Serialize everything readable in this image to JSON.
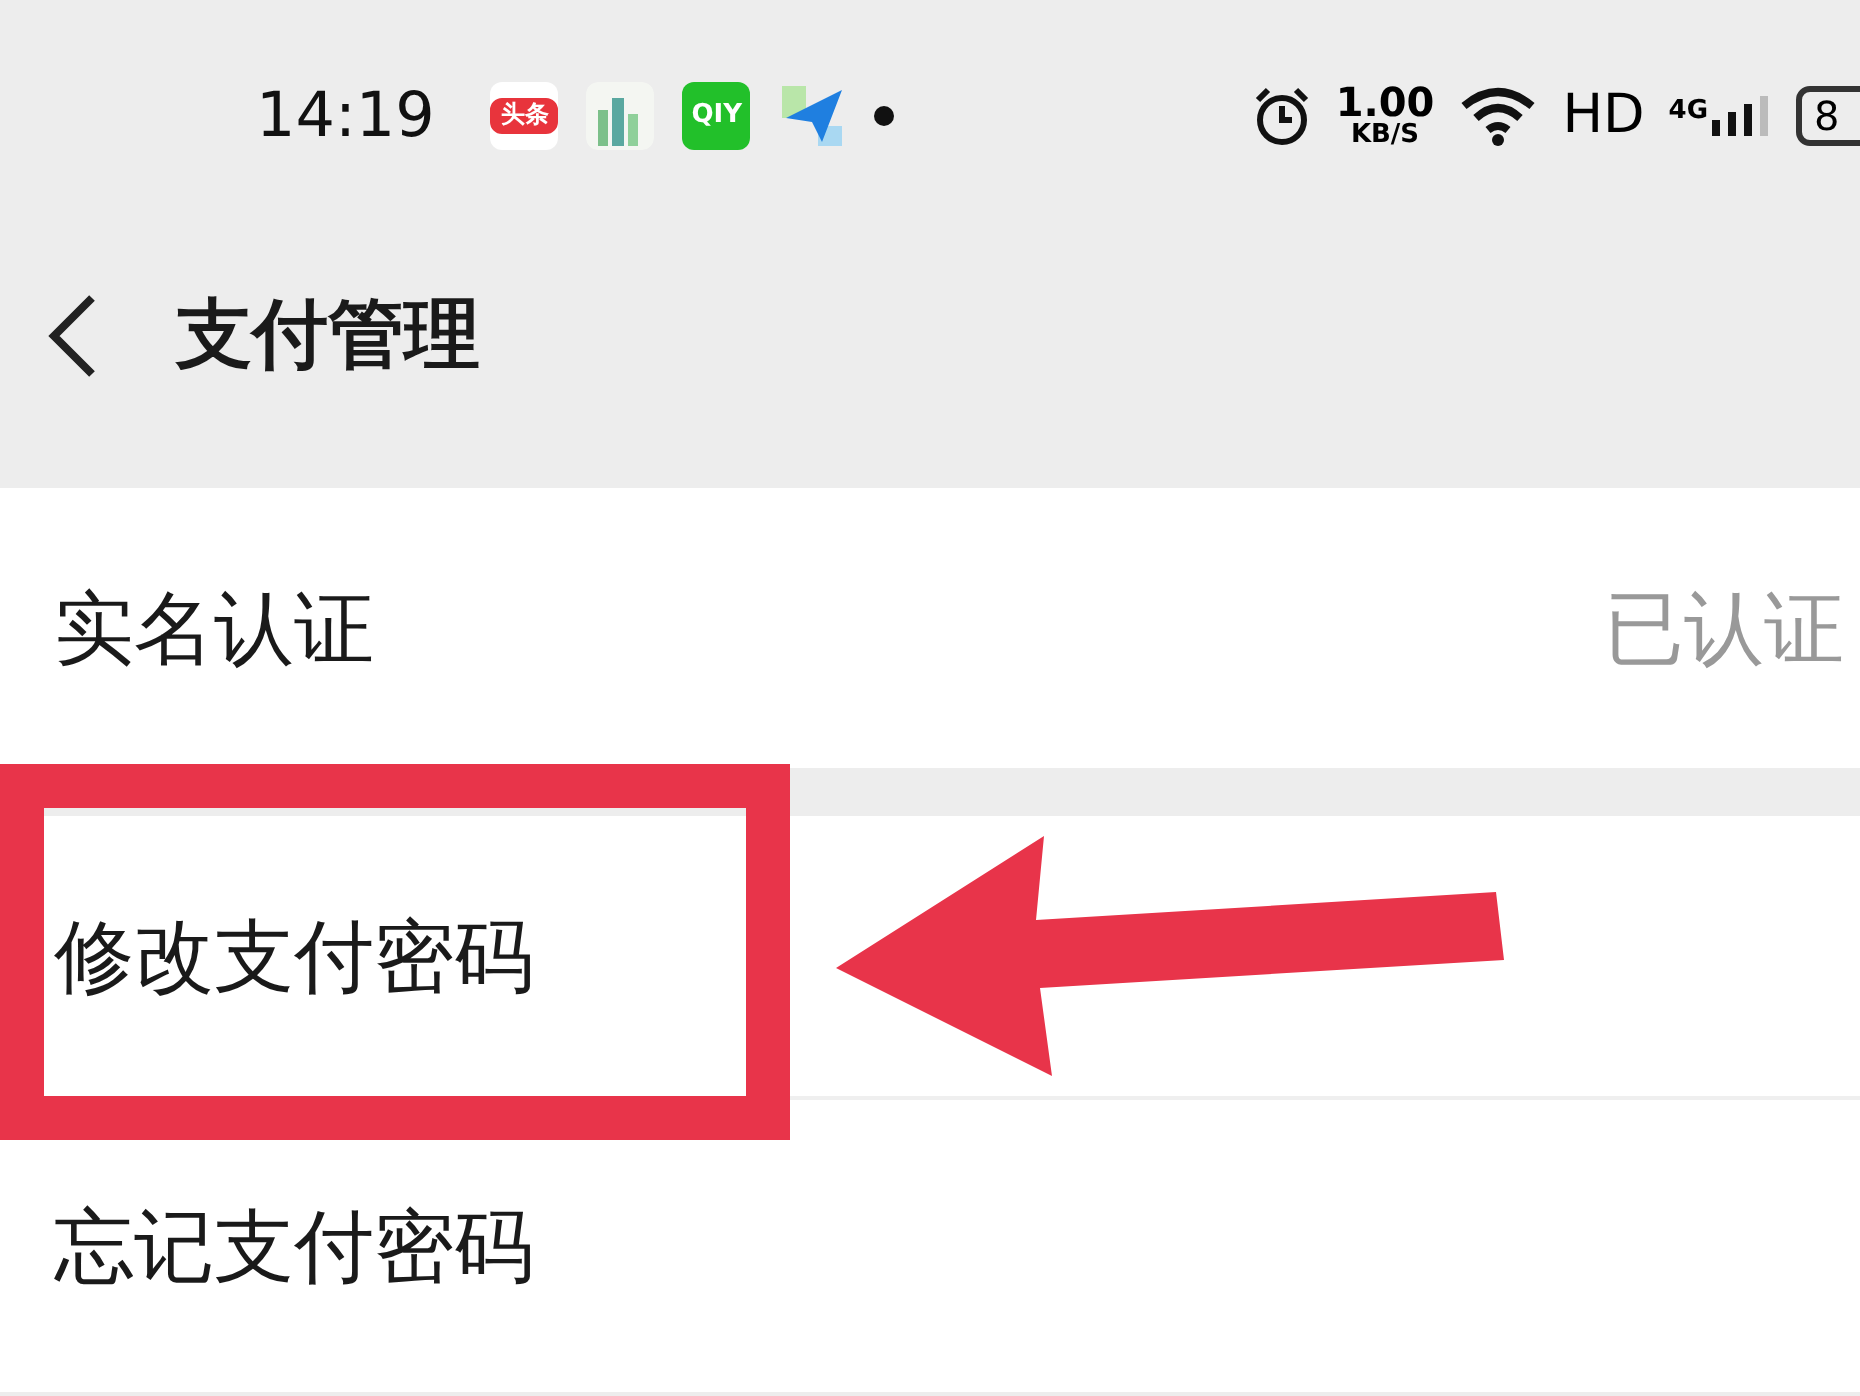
{
  "status_bar": {
    "time": "14:19",
    "apps": [
      {
        "kind": "news",
        "label": "头条"
      },
      {
        "kind": "city"
      },
      {
        "kind": "video",
        "label": "QIY"
      },
      {
        "kind": "plane"
      }
    ],
    "speed": "1.00",
    "speed_unit": "KB/S",
    "hd": "HD",
    "network": "4G",
    "battery": "8"
  },
  "header": {
    "title": "支付管理"
  },
  "groups": [
    [
      {
        "label": "实名认证",
        "value": "已认证",
        "highlighted": false
      }
    ],
    [
      {
        "label": "修改支付密码",
        "highlighted": true
      },
      {
        "label": "忘记支付密码",
        "highlighted": false
      }
    ]
  ]
}
